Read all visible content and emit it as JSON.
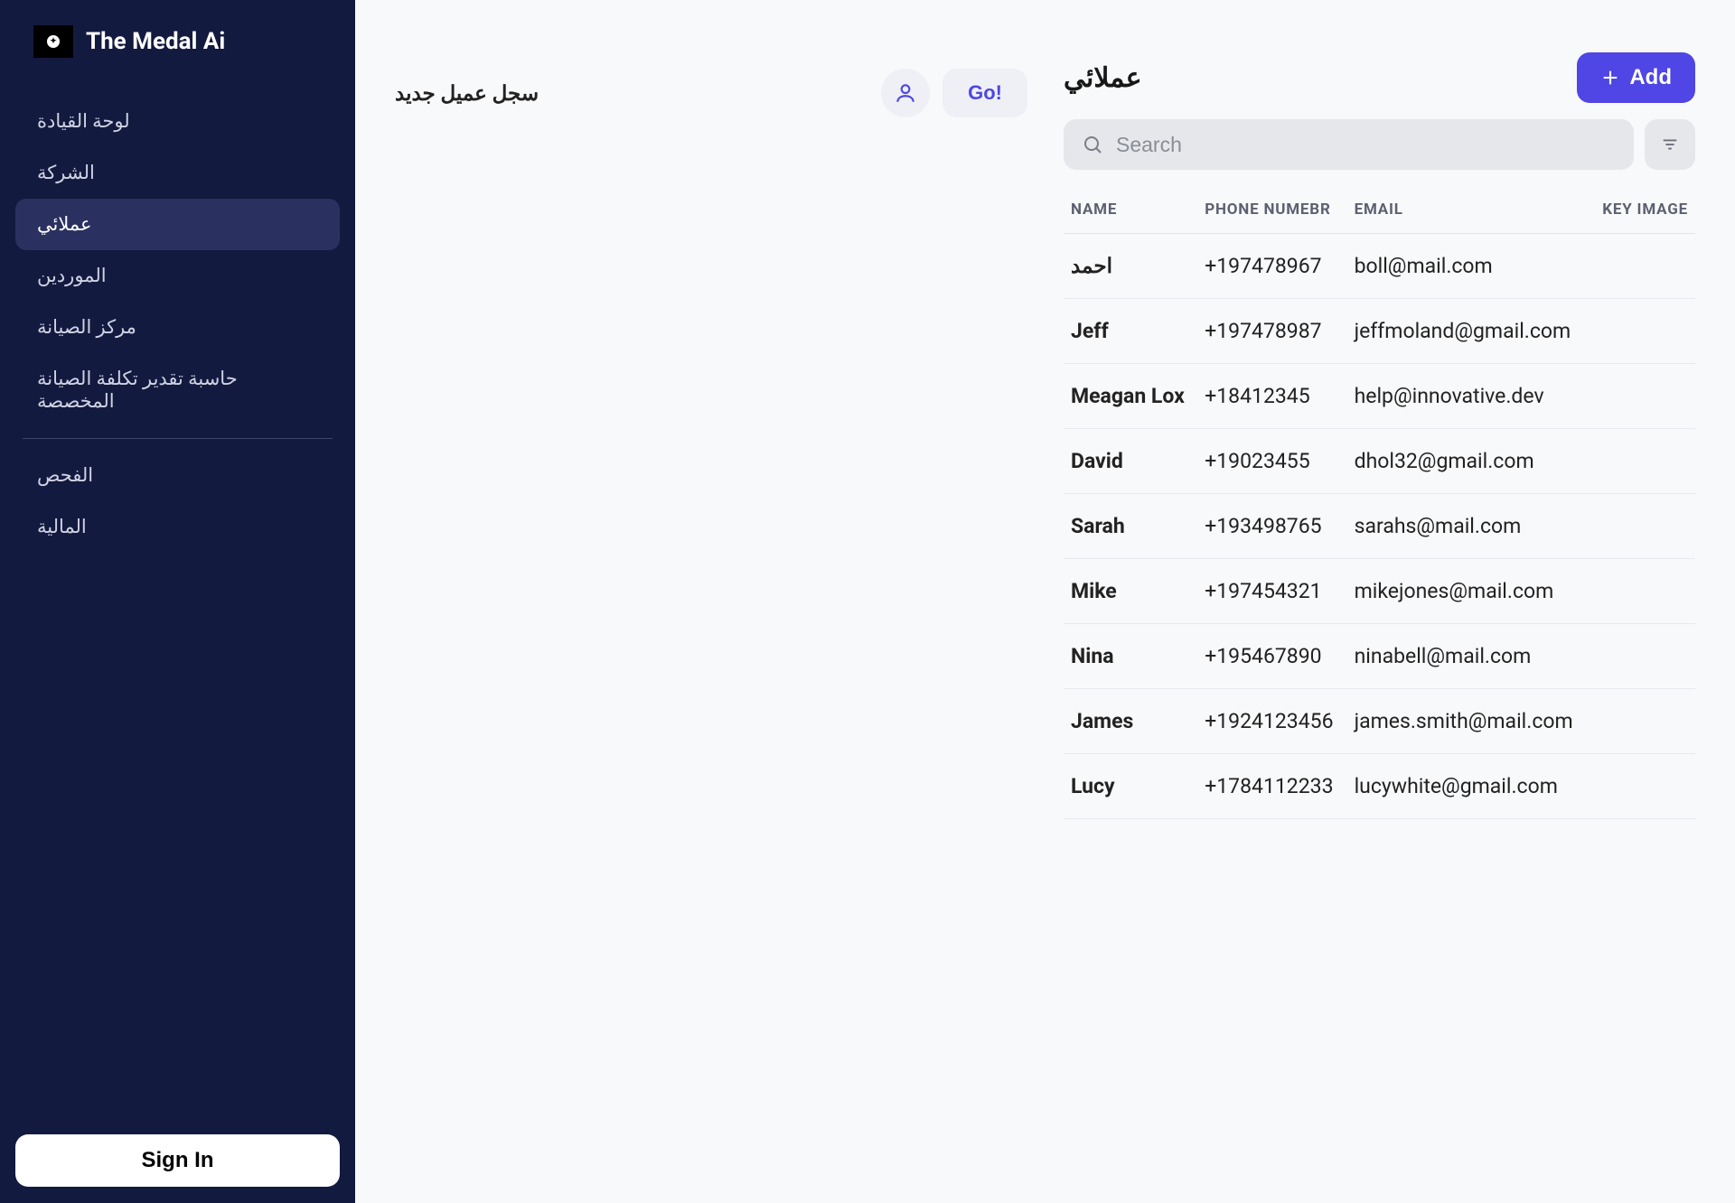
{
  "brand": {
    "title": "The Medal Ai"
  },
  "sidebar": {
    "items": [
      {
        "label": "لوحة القيادة"
      },
      {
        "label": "الشركة"
      },
      {
        "label": "عملائي"
      },
      {
        "label": "الموردين"
      },
      {
        "label": "مركز الصيانة"
      },
      {
        "label": "حاسبة تقدير تكلفة الصيانة المخصصة"
      }
    ],
    "items2": [
      {
        "label": "الفحص"
      },
      {
        "label": "المالية"
      }
    ],
    "signin_label": "Sign In"
  },
  "register": {
    "title": "سجل عميل جديد",
    "go_label": "Go!"
  },
  "clients_panel": {
    "title": "عملائي",
    "add_label": "Add",
    "search_placeholder": "Search",
    "columns": [
      "NAME",
      "PHONE NUMEBR",
      "EMAIL",
      "KEY IMAGE"
    ],
    "rows": [
      {
        "name": "احمد",
        "phone": "+197478967",
        "email": "boll@mail.com"
      },
      {
        "name": "Jeff",
        "phone": "+197478987",
        "email": "jeffmoland@gmail.com"
      },
      {
        "name": "Meagan Lox",
        "phone": "+18412345",
        "email": "help@innovative.dev"
      },
      {
        "name": "David",
        "phone": "+19023455",
        "email": "dhol32@gmail.com"
      },
      {
        "name": "Sarah",
        "phone": "+193498765",
        "email": "sarahs@mail.com"
      },
      {
        "name": "Mike",
        "phone": "+197454321",
        "email": "mikejones@mail.com"
      },
      {
        "name": "Nina",
        "phone": "+195467890",
        "email": "ninabell@mail.com"
      },
      {
        "name": "James",
        "phone": "+1924123456",
        "email": "james.smith@mail.com"
      },
      {
        "name": "Lucy",
        "phone": "+1784112233",
        "email": "lucywhite@gmail.com"
      }
    ]
  }
}
